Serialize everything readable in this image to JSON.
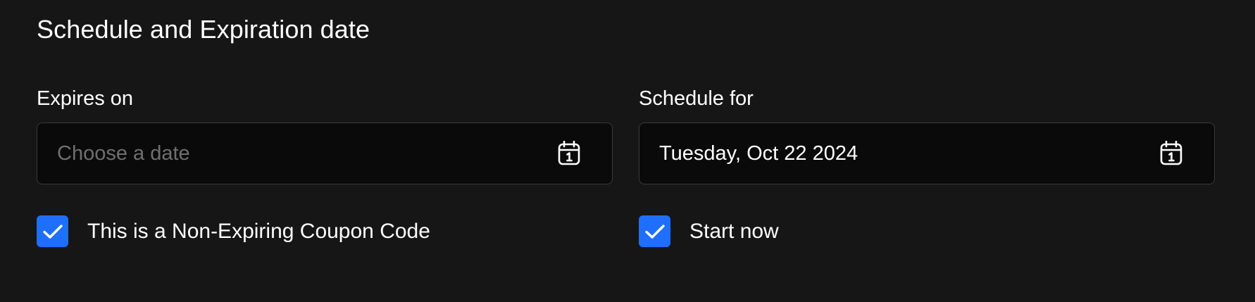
{
  "section": {
    "title": "Schedule and Expiration date"
  },
  "expires": {
    "label": "Expires on",
    "placeholder": "Choose a date",
    "value": "",
    "icon": "calendar-icon",
    "checkbox_label": "This is a Non-Expiring Coupon Code",
    "checkbox_checked": true
  },
  "schedule": {
    "label": "Schedule for",
    "placeholder": "",
    "value": "Tuesday, Oct 22 2024",
    "icon": "calendar-icon",
    "checkbox_label": "Start now",
    "checkbox_checked": true
  },
  "colors": {
    "background": "#161616",
    "input_background": "#0a0a0a",
    "input_border": "#3a3a3a",
    "checkbox_accent": "#1f6fff",
    "placeholder_text": "#6f6f6f",
    "text": "#ffffff"
  }
}
